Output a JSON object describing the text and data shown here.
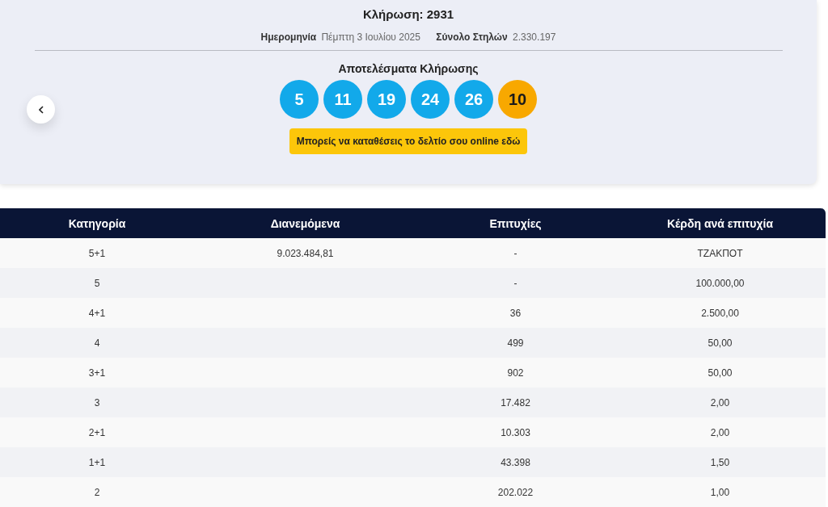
{
  "draw": {
    "title": "Κλήρωση: 2931",
    "date_label": "Ημερομηνία",
    "date_value": "Πέμπτη 3 Ιουλίου 2025",
    "columns_label": "Σύνολο Στηλών",
    "columns_value": "2.330.197"
  },
  "results": {
    "heading": "Αποτελέσματα Κλήρωσης",
    "balls": [
      {
        "number": "5",
        "kind": "main"
      },
      {
        "number": "11",
        "kind": "main"
      },
      {
        "number": "19",
        "kind": "main"
      },
      {
        "number": "24",
        "kind": "main"
      },
      {
        "number": "26",
        "kind": "main"
      },
      {
        "number": "10",
        "kind": "bonus"
      }
    ],
    "cta": "Μπορείς να καταθέσεις το δελτίο σου online εδώ"
  },
  "table": {
    "columns": [
      "Κατηγορία",
      "Διανεμόμενα",
      "Επιτυχίες",
      "Κέρδη ανά επιτυχία"
    ],
    "rows": [
      [
        "5+1",
        "9.023.484,81",
        "-",
        "ΤΖΑΚΠΟΤ"
      ],
      [
        "5",
        "",
        "-",
        "100.000,00"
      ],
      [
        "4+1",
        "",
        "36",
        "2.500,00"
      ],
      [
        "4",
        "",
        "499",
        "50,00"
      ],
      [
        "3+1",
        "",
        "902",
        "50,00"
      ],
      [
        "3",
        "",
        "17.482",
        "2,00"
      ],
      [
        "2+1",
        "",
        "10.303",
        "2,00"
      ],
      [
        "1+1",
        "",
        "43.398",
        "1,50"
      ],
      [
        "2",
        "",
        "202.022",
        "1,00"
      ]
    ]
  }
}
